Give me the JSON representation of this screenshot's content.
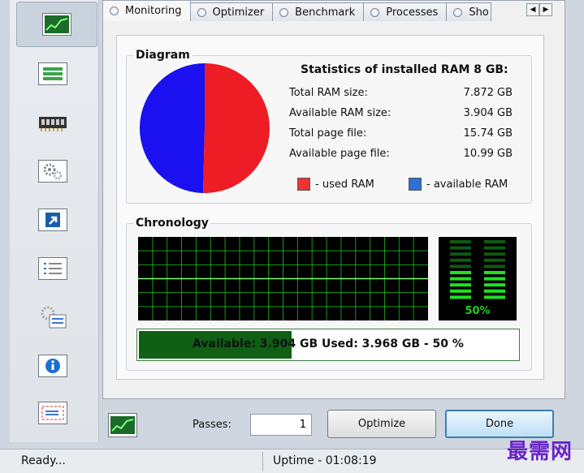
{
  "tabs": [
    {
      "label": "Monitoring"
    },
    {
      "label": "Optimizer"
    },
    {
      "label": "Benchmark"
    },
    {
      "label": "Processes"
    },
    {
      "label": "Sho"
    }
  ],
  "sidebar": {
    "items": [
      {
        "icon": "memory-graph-icon"
      },
      {
        "icon": "list-bars-icon"
      },
      {
        "icon": "ram-chip-icon"
      },
      {
        "icon": "gears-icon"
      },
      {
        "icon": "shortcut-arrow-icon"
      },
      {
        "icon": "checklist-icon"
      },
      {
        "icon": "settings-checklist-icon"
      },
      {
        "icon": "info-icon"
      },
      {
        "icon": "mail-icon"
      }
    ]
  },
  "diagram": {
    "title": "Diagram",
    "used_fraction": 0.504,
    "used_color": "#ee1c24",
    "available_color": "#1a10f0"
  },
  "stats": {
    "title": "Statistics of installed RAM 8 GB:",
    "rows": [
      {
        "label": "Total RAM size:",
        "value": "7.872 GB"
      },
      {
        "label": "Available RAM size:",
        "value": "3.904 GB"
      },
      {
        "label": "Total page file:",
        "value": "15.74 GB"
      },
      {
        "label": "Available page file:",
        "value": "10.99 GB"
      }
    ]
  },
  "legend": {
    "used_label": "- used RAM",
    "available_label": "- available RAM"
  },
  "chronology": {
    "title": "Chronology",
    "grid_color": "#1fcf1f",
    "usage_percent": 50,
    "meter_label": "50%"
  },
  "usage_bar": {
    "text": "Available: 3.904 GB  Used: 3.968 GB - 50 %",
    "fill_fraction": 0.4
  },
  "bottom": {
    "passes_label": "Passes:",
    "passes_value": "1",
    "optimize_label": "Optimize",
    "done_label": "Done"
  },
  "statusbar": {
    "status": "Ready...",
    "uptime": "Uptime - 01:08:19"
  },
  "watermark": "最需网"
}
